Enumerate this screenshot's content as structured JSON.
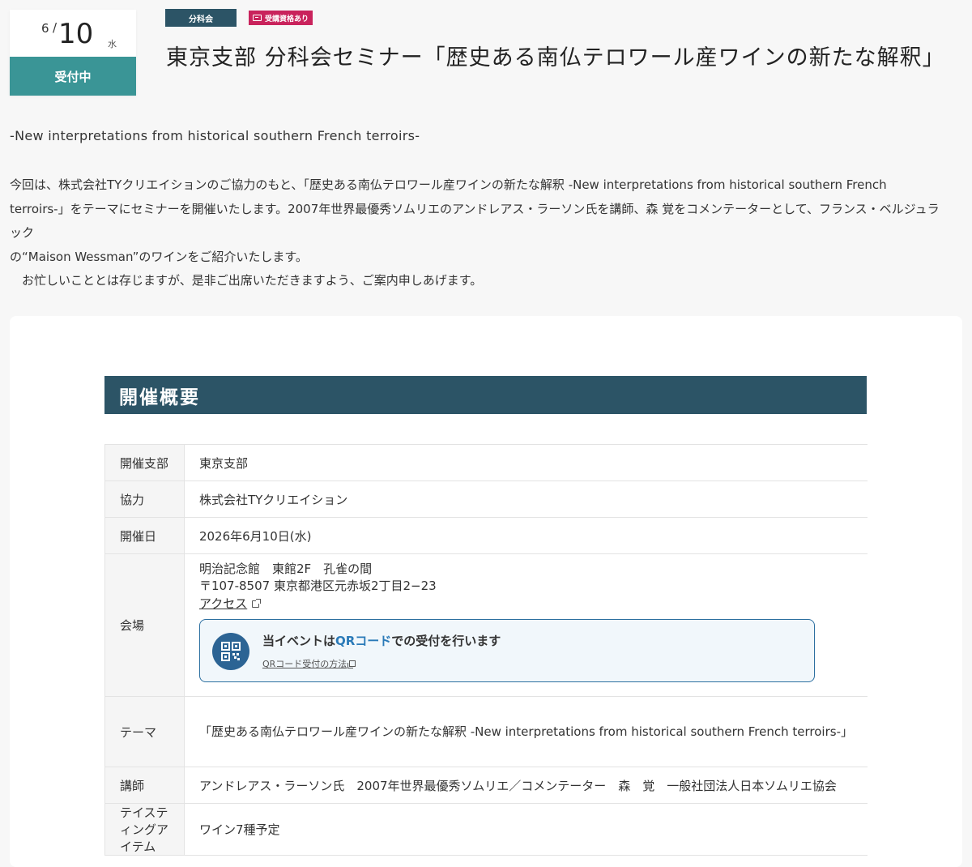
{
  "date": {
    "month": "6",
    "day": "10",
    "weekday": "水",
    "status": "受付中"
  },
  "tags": {
    "category": "分科会",
    "credit": "受講資格あり"
  },
  "title": "東京支部 分科会セミナー「歴史ある南仏テロワール産ワインの新たな解釈」",
  "subtitle": "-New interpretations from historical southern French terroirs-",
  "intro": {
    "line1": "今回は、株式会社TYクリエイションのご協力のもと、「歴史ある南仏テロワール産ワインの新たな解釈 -New interpretations from historical southern French",
    "line2": "terroirs-」をテーマにセミナーを開催いたします。2007年世界最優秀ソムリエのアンドレアス・ラーソン氏を講師、森 覚をコメンテーターとして、フランス・ベルジュラック",
    "line3": "の“Maison Wessman”のワインをご紹介いたします。",
    "line4": "　お忙しいこととは存じますが、是非ご出席いただきますよう、ご案内申しあげます。"
  },
  "overview": {
    "heading": "開催概要",
    "branch_label": "開催支部",
    "branch_value": "東京支部",
    "cooperation_label": "協力",
    "cooperation_value": "株式会社TYクリエイション",
    "date_label": "開催日",
    "date_value": "2026年6月10日(水)",
    "venue_label": "会場",
    "venue_name": "明治記念館　東館2F　孔雀の間",
    "venue_address": "〒107-8507 東京都港区元赤坂2丁目2−23",
    "access_label": "アクセス",
    "qr": {
      "title_prefix": "当イベントは",
      "title_highlight": "QRコード",
      "title_suffix": "での受付を行います",
      "link": "QRコード受付の方法"
    },
    "theme_label": "テーマ",
    "theme_value": "「歴史ある南仏テロワール産ワインの新たな解釈 -New interpretations from historical southern French terroirs-」",
    "lecturer_label": "講師",
    "lecturer_value": "アンドレアス・ラーソン氏　2007年世界最優秀ソムリエ／コメンテーター　森　覚　一般社団法人日本ソムリエ協会",
    "tasting_label": "テイスティングアイテム",
    "tasting_value": "ワイン7種予定"
  },
  "colors": {
    "accent_teal": "#3a9596",
    "navy": "#2c5466",
    "pink": "#c9235c",
    "qr_blue": "#2a7ab8"
  },
  "icons": [
    "external-link-icon",
    "qr-code-icon",
    "copy-icon",
    "certificate-icon"
  ]
}
